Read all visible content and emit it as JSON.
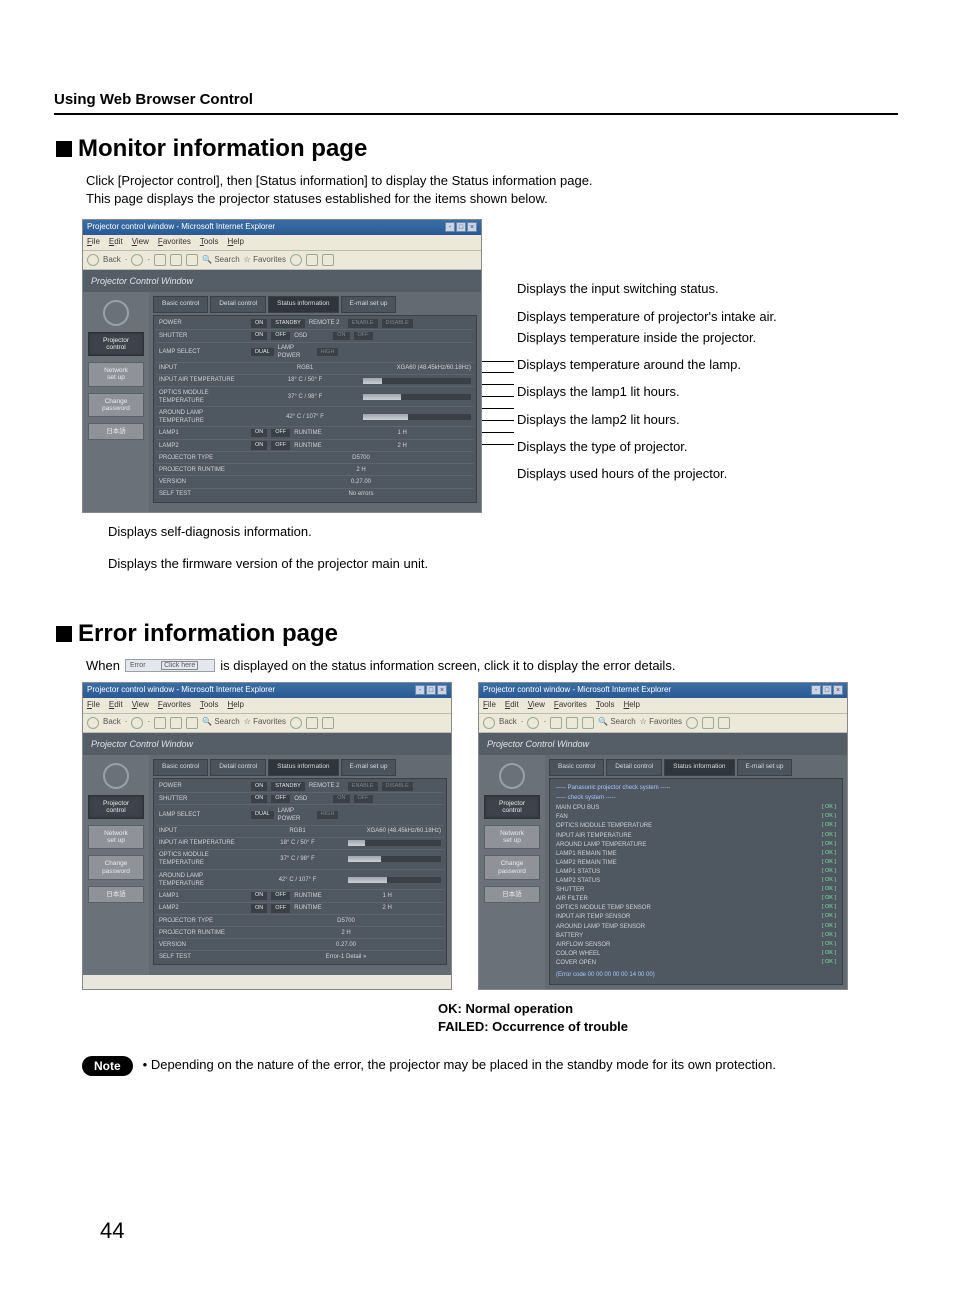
{
  "page": {
    "section_header": "Using Web Browser Control",
    "page_number": "44",
    "note_label": "Note"
  },
  "monitor": {
    "heading": "Monitor information page",
    "intro_line1": "Click [Projector control], then [Status information] to display the Status information page.",
    "intro_line2": "This page displays the projector statuses established for the items shown below.",
    "caption_selfdiag": "Displays self-diagnosis information.",
    "caption_firmware": "Displays the firmware version of the projector main unit.",
    "callouts": [
      "Displays the input switching status.",
      "Displays temperature of projector's intake air.",
      "Displays temperature inside the projector.",
      "Displays temperature around the lamp.",
      "Displays the lamp1 lit hours.",
      "Displays the lamp2 lit hours.",
      "Displays the type of projector.",
      "Displays used hours of the projector."
    ]
  },
  "error": {
    "heading": "Error information page",
    "intro_before": "When",
    "chip_left": "Error",
    "chip_right": "Click here",
    "intro_after": "is displayed on the status information screen, click it to display the error details.",
    "ok_line": "OK: Normal operation",
    "failed_line": "FAILED: Occurrence of trouble",
    "note_text": "• Depending on the nature of the error, the projector may be placed in the standby mode for its own protection."
  },
  "browser": {
    "title": "Projector control window - Microsoft Internet Explorer",
    "menus": [
      "File",
      "Edit",
      "View",
      "Favorites",
      "Tools",
      "Help"
    ],
    "toolbar": {
      "back": "Back",
      "search": "Search",
      "favorites": "Favorites"
    },
    "banner": "Projector Control Window",
    "sidebar": [
      {
        "label": "Projector\ncontrol",
        "active": true
      },
      {
        "label": "Network\nset up",
        "active": false
      },
      {
        "label": "Change\npassword",
        "active": false
      },
      {
        "label": "日本語",
        "active": false
      }
    ],
    "tabs": [
      {
        "label": "Basic control",
        "active": false
      },
      {
        "label": "Detail control",
        "active": false
      },
      {
        "label": "Status information",
        "active": true
      },
      {
        "label": "E-mail set up",
        "active": false
      }
    ],
    "status_rows": [
      {
        "label": "POWER",
        "items": [
          "ON",
          "STANDBY"
        ],
        "label2": "REMOTE 2",
        "items2": [
          "ENABLE",
          "DISABLE"
        ]
      },
      {
        "label": "SHUTTER",
        "items": [
          "ON",
          "OFF"
        ],
        "label2": "OSD",
        "items2": [
          "ON",
          "OFF"
        ]
      },
      {
        "label": "LAMP SELECT",
        "items": [
          "DUAL"
        ],
        "label2": "LAMP POWER",
        "items2": [
          "HIGH"
        ]
      },
      {
        "label": "INPUT",
        "center": "RGB1",
        "right": "XGA60 (48.45kHz/60.18Hz)"
      },
      {
        "label": "INPUT AIR TEMPERATURE",
        "center": "18° C / 50° F",
        "bar": 0.18
      },
      {
        "label": "OPTICS MODULE TEMPERATURE",
        "center": "37° C / 98° F",
        "bar": 0.35
      },
      {
        "label": "AROUND LAMP TEMPERATURE",
        "center": "42° C / 107° F",
        "bar": 0.42
      },
      {
        "label": "LAMP1",
        "items": [
          "ON",
          "OFF"
        ],
        "label2": "RUNTIME",
        "center": "1 H"
      },
      {
        "label": "LAMP2",
        "items": [
          "ON",
          "OFF"
        ],
        "label2": "RUNTIME",
        "center": "2 H"
      },
      {
        "label": "PROJECTOR TYPE",
        "center": "D5700"
      },
      {
        "label": "PROJECTOR RUNTIME",
        "center": "2 H"
      },
      {
        "label": "VERSION",
        "center": "0.27.00"
      },
      {
        "label": "SELF TEST",
        "center": "No errors"
      }
    ],
    "status_rows_err": {
      "label": "SELF TEST",
      "center": "Error-1  Detail  »"
    },
    "diag": {
      "header1": "----- Panasonic projector check system -----",
      "header2": "----- check system -----",
      "items": [
        "MAIN CPU BUS",
        "FAN",
        "OPTICS MODULE TEMPERATURE",
        "INPUT AIR TEMPERATURE",
        "AROUND LAMP TEMPERATURE",
        "LAMP1 REMAIN TIME",
        "LAMP2 REMAIN TIME",
        "LAMP1 STATUS",
        "LAMP2 STATUS",
        "SHUTTER",
        "AIR FILTER",
        "OPTICS MODULE TEMP SENSOR",
        "INPUT AIR TEMP SENSOR",
        "AROUND LAMP TEMP SENSOR",
        "BATTERY",
        "AIRFLOW SENSOR",
        "COLOR WHEEL",
        "COVER OPEN"
      ],
      "status": "[ OK ]",
      "errcode": "(Error code 00 00 00 00 00 14 00 00)"
    }
  }
}
